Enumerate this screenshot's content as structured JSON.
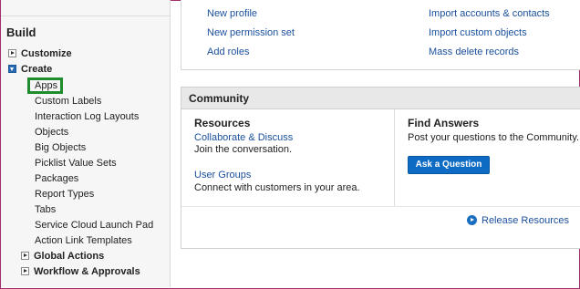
{
  "sidebar": {
    "section_title": "Build",
    "customize": {
      "label": "Customize",
      "state": "collapsed"
    },
    "create": {
      "label": "Create",
      "state": "expanded"
    },
    "create_children": [
      "Apps",
      "Custom Labels",
      "Interaction Log Layouts",
      "Objects",
      "Big Objects",
      "Picklist Value Sets",
      "Packages",
      "Report Types",
      "Tabs",
      "Service Cloud Launch Pad",
      "Action Link Templates"
    ],
    "global_actions": {
      "label": "Global Actions",
      "state": "collapsed"
    },
    "workflow": {
      "label": "Workflow & Approvals",
      "state": "collapsed"
    },
    "highlight_color": "#1f8d2e"
  },
  "quick_links": {
    "left": [
      "New profile",
      "New permission set",
      "Add roles"
    ],
    "right": [
      "Import accounts & contacts",
      "Import custom objects",
      "Mass delete records"
    ]
  },
  "community": {
    "title": "Community",
    "resources": {
      "heading": "Resources",
      "collab_link": "Collaborate & Discuss",
      "collab_desc": "Join the conversation.",
      "groups_link": "User Groups",
      "groups_desc": "Connect with customers in your area."
    },
    "answers": {
      "heading": "Find Answers",
      "desc": "Post your questions to the Community.",
      "button": "Ask a Question"
    },
    "release_link": "Release Resources"
  },
  "colors": {
    "link": "#1a4f9c",
    "button": "#0e6bc4",
    "frame_border": "#a0306b"
  }
}
